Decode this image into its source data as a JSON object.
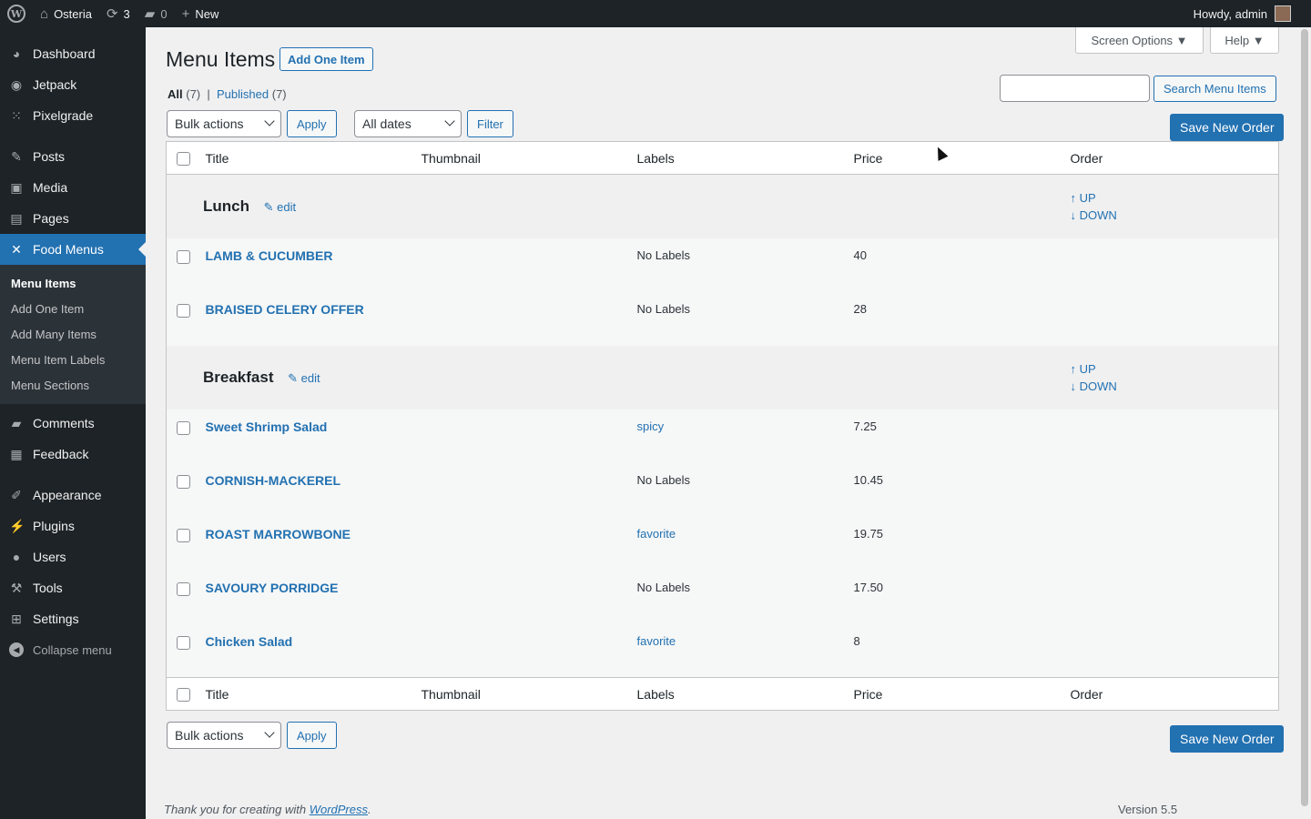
{
  "adminbar": {
    "site_name": "Osteria",
    "updates_count": "3",
    "comments_count": "0",
    "new_label": "New",
    "howdy": "Howdy, admin",
    "icons": [
      "wordpress-logo-icon",
      "home-icon",
      "updates-icon",
      "comments-icon",
      "plus-icon"
    ]
  },
  "sidebar": {
    "items": [
      {
        "label": "Dashboard",
        "icon": "dashboard-icon"
      },
      {
        "label": "Jetpack",
        "icon": "jetpack-icon"
      },
      {
        "label": "Pixelgrade",
        "icon": "grid-dots-icon"
      },
      {
        "label": "Posts",
        "icon": "pin-icon"
      },
      {
        "label": "Media",
        "icon": "media-icon"
      },
      {
        "label": "Pages",
        "icon": "pages-icon"
      },
      {
        "label": "Food Menus",
        "icon": "utensils-icon"
      },
      {
        "label": "Comments",
        "icon": "comments-icon"
      },
      {
        "label": "Feedback",
        "icon": "feedback-icon"
      },
      {
        "label": "Appearance",
        "icon": "brush-icon"
      },
      {
        "label": "Plugins",
        "icon": "plug-icon"
      },
      {
        "label": "Users",
        "icon": "user-icon"
      },
      {
        "label": "Tools",
        "icon": "wrench-icon"
      },
      {
        "label": "Settings",
        "icon": "settings-icon"
      }
    ],
    "submenu": [
      "Menu Items",
      "Add One Item",
      "Add Many Items",
      "Menu Item Labels",
      "Menu Sections"
    ],
    "collapse_label": "Collapse menu"
  },
  "header": {
    "title": "Menu Items",
    "add_button": "Add One Item",
    "screen_options": "Screen Options ▼",
    "help": "Help ▼"
  },
  "filters": {
    "all_label": "All",
    "all_count": "(7)",
    "separator": "|",
    "published_label": "Published",
    "published_count": "(7)",
    "bulk_actions": "Bulk actions",
    "apply": "Apply",
    "all_dates": "All dates",
    "filter": "Filter",
    "search_button": "Search Menu Items",
    "save_order": "Save New Order"
  },
  "table": {
    "columns": [
      "Title",
      "Thumbnail",
      "Labels",
      "Price",
      "Order"
    ],
    "up_label": "↑ UP",
    "down_label": "↓ DOWN",
    "edit_label": "edit",
    "sections": [
      {
        "name": "Lunch",
        "items": [
          {
            "title": "LAMB & CUCUMBER",
            "label": "No Labels",
            "label_link": false,
            "price": "40"
          },
          {
            "title": "BRAISED CELERY OFFER",
            "label": "No Labels",
            "label_link": false,
            "price": "28"
          }
        ]
      },
      {
        "name": "Breakfast",
        "items": [
          {
            "title": "Sweet Shrimp Salad",
            "label": "spicy",
            "label_link": true,
            "price": "7.25"
          },
          {
            "title": "CORNISH-MACKEREL",
            "label": "No Labels",
            "label_link": false,
            "price": "10.45"
          },
          {
            "title": "ROAST MARROWBONE",
            "label": "favorite",
            "label_link": true,
            "price": "19.75"
          },
          {
            "title": "SAVOURY PORRIDGE",
            "label": "No Labels",
            "label_link": false,
            "price": "17.50"
          },
          {
            "title": "Chicken Salad",
            "label": "favorite",
            "label_link": true,
            "price": "8"
          }
        ]
      }
    ]
  },
  "footer": {
    "thanks_prefix": "Thank you for creating with ",
    "wordpress_link": "WordPress",
    "thanks_suffix": ".",
    "version": "Version 5.5"
  },
  "colors": {
    "accent": "#2271b1",
    "sidebar_bg": "#1d2327",
    "page_bg": "#f0f0f1"
  }
}
